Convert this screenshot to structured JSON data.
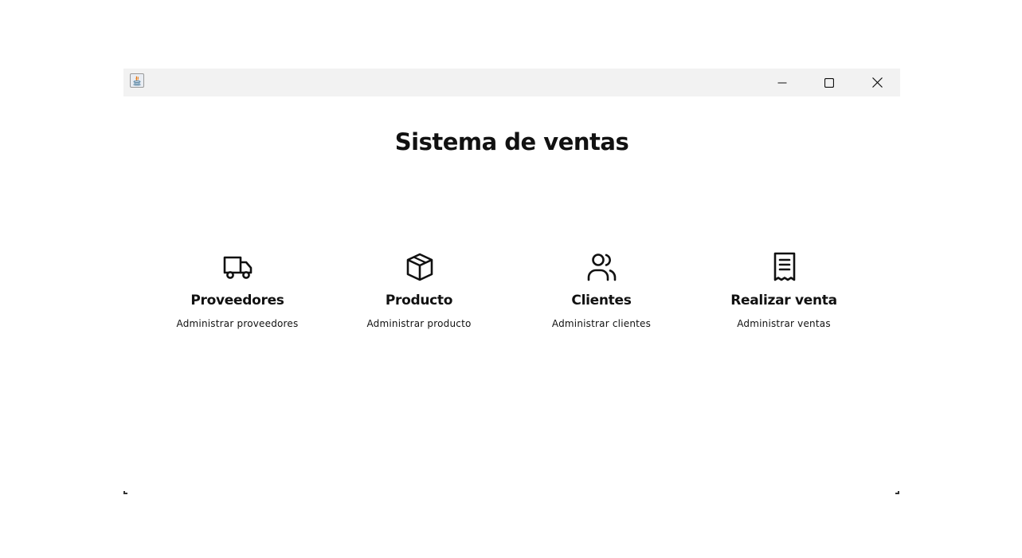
{
  "window": {
    "title": "",
    "controls": {
      "minimize_icon": "minimize-icon",
      "maximize_icon": "maximize-icon",
      "close_icon": "close-icon"
    }
  },
  "main": {
    "title": "Sistema de ventas",
    "modules": [
      {
        "icon": "truck-icon",
        "label": "Proveedores",
        "description": "Administrar proveedores"
      },
      {
        "icon": "box-icon",
        "label": "Producto",
        "description": "Administrar producto"
      },
      {
        "icon": "users-icon",
        "label": "Clientes",
        "description": "Administrar clientes"
      },
      {
        "icon": "receipt-icon",
        "label": "Realizar venta",
        "description": "Administrar ventas"
      }
    ]
  },
  "colors": {
    "titlebar": "#f2f2f2",
    "background": "#ffffff",
    "text": "#111111"
  }
}
